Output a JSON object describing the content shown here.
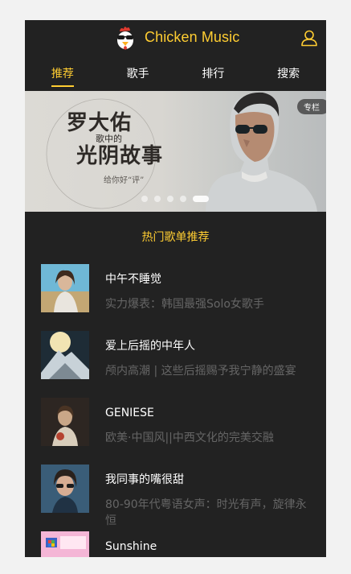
{
  "header": {
    "title": "Chicken Music",
    "logo_icon": "chicken-logo-icon",
    "user_icon": "user-icon",
    "accent_color": "#ffcd32"
  },
  "tabs": [
    {
      "label": "推荐",
      "active": true
    },
    {
      "label": "歌手",
      "active": false
    },
    {
      "label": "排行",
      "active": false
    },
    {
      "label": "搜索",
      "active": false
    }
  ],
  "banner": {
    "badge": "专栏",
    "title_line1": "罗大佑",
    "title_line2": "歌中的",
    "title_line3": "光阴故事",
    "caption": "给你好“评”",
    "slide_count": 5,
    "active_slide": 4
  },
  "section_title": "热门歌单推荐",
  "playlists": [
    {
      "name": "中午不睡觉",
      "desc": "实力爆表：韩国最强Solo女歌手"
    },
    {
      "name": "爱上后摇的中年人",
      "desc": "颅内高潮 | 这些后摇赐予我宁静的盛宴"
    },
    {
      "name": "GENIESE",
      "desc": "欧美·中国风||中西文化的完美交融"
    },
    {
      "name": "我同事的嘴很甜",
      "desc": "80-90年代粤语女声：时光有声，旋律永恒"
    },
    {
      "name": "Sunshine",
      "desc": ""
    }
  ]
}
